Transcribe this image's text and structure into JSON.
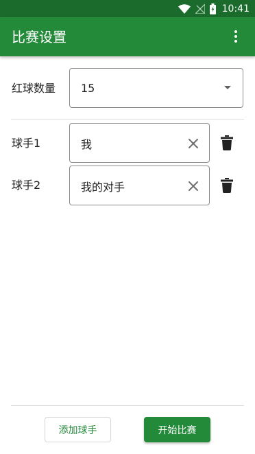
{
  "status_bar": {
    "time": "10:41",
    "icons": [
      "wifi-icon",
      "signal-off-icon",
      "battery-charging-icon"
    ]
  },
  "app_bar": {
    "title": "比赛设置",
    "menu_icon": "more-vert-icon"
  },
  "red_balls": {
    "label": "红球数量",
    "selected": "15"
  },
  "players": [
    {
      "label": "球手1",
      "name": "我"
    },
    {
      "label": "球手2",
      "name": "我的对手"
    }
  ],
  "actions": {
    "add_player": "添加球手",
    "start_match": "开始比赛"
  },
  "colors": {
    "primary": "#238a3a",
    "status_bar": "#1b6b2c"
  }
}
